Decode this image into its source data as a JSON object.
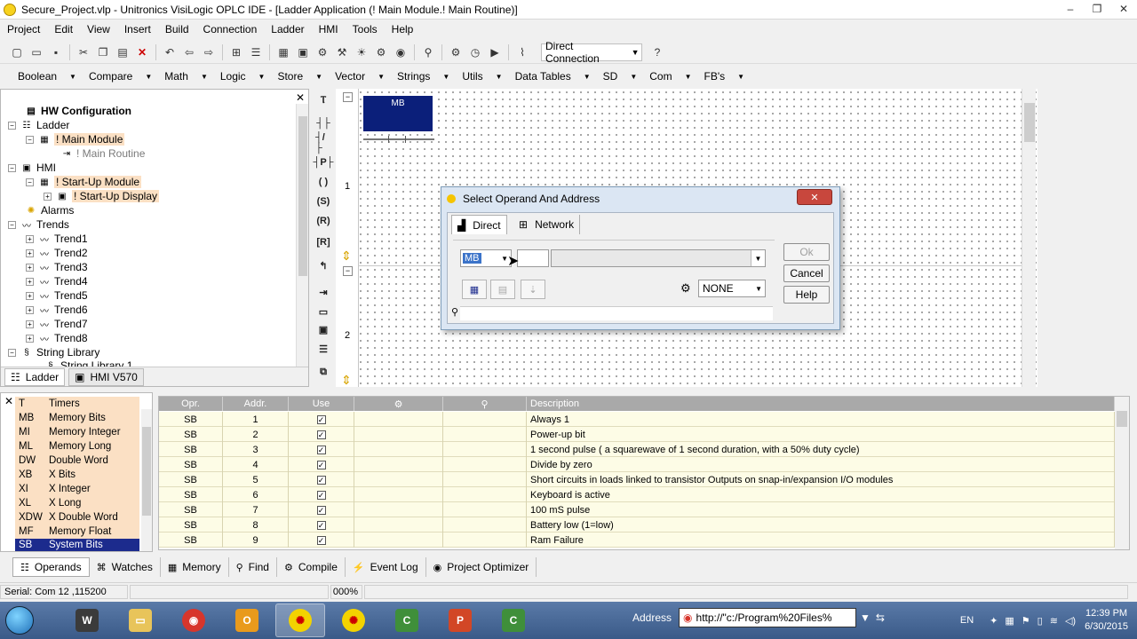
{
  "window": {
    "title": "Secure_Project.vlp - Unitronics VisiLogic OPLC IDE - [Ladder Application (! Main Module.! Main Routine)]",
    "controls": [
      "–",
      "❐",
      "✕"
    ]
  },
  "menu": [
    "Project",
    "Edit",
    "View",
    "Insert",
    "Build",
    "Connection",
    "Ladder",
    "HMI",
    "Tools",
    "Help"
  ],
  "toolbar": {
    "connection_value": "Direct Connection"
  },
  "element_menus": [
    "Boolean",
    "Compare",
    "Math",
    "Logic",
    "Store",
    "Vector",
    "Strings",
    "Utils",
    "Data Tables",
    "SD",
    "Com",
    "FB's"
  ],
  "tree": {
    "hw_config": "HW Configuration",
    "ladder": "Ladder",
    "main_module": "! Main Module",
    "main_routine": "! Main Routine",
    "hmi": "HMI",
    "startup_module": "! Start-Up Module",
    "startup_display": "! Start-Up Display",
    "alarms": "Alarms",
    "trends": "Trends",
    "trend_items": [
      "Trend1",
      "Trend2",
      "Trend3",
      "Trend4",
      "Trend5",
      "Trend6",
      "Trend7",
      "Trend8"
    ],
    "string_library": "String Library",
    "string_library_child": "String Library 1",
    "tabs": [
      "Ladder",
      "HMI V570"
    ]
  },
  "ladder": {
    "rung_numbers": [
      "1",
      "2"
    ],
    "block_label": "MB"
  },
  "dialog": {
    "title": "Select Operand And Address",
    "close": "✕",
    "tabs": [
      "Direct",
      "Network"
    ],
    "operand_value": "MB",
    "address_value": "",
    "format_value": "NONE",
    "buttons": {
      "ok": "Ok",
      "cancel": "Cancel",
      "help": "Help"
    }
  },
  "operands": [
    {
      "code": "T",
      "name": "Timers"
    },
    {
      "code": "MB",
      "name": "Memory Bits"
    },
    {
      "code": "MI",
      "name": "Memory Integer"
    },
    {
      "code": "ML",
      "name": "Memory Long"
    },
    {
      "code": "DW",
      "name": "Double Word"
    },
    {
      "code": "XB",
      "name": "X Bits"
    },
    {
      "code": "XI",
      "name": "X Integer"
    },
    {
      "code": "XL",
      "name": "X Long"
    },
    {
      "code": "XDW",
      "name": "X Double Word"
    },
    {
      "code": "MF",
      "name": "Memory Float"
    },
    {
      "code": "SB",
      "name": "System Bits"
    }
  ],
  "table": {
    "headers": {
      "opr": "Opr.",
      "addr": "Addr.",
      "use": "Use",
      "desc": "Description"
    },
    "rows": [
      {
        "opr": "SB",
        "addr": "1",
        "desc": "Always 1"
      },
      {
        "opr": "SB",
        "addr": "2",
        "desc": "Power-up bit"
      },
      {
        "opr": "SB",
        "addr": "3",
        "desc": "1 second pulse ( a squarewave of 1 second duration, with a 50% duty cycle)"
      },
      {
        "opr": "SB",
        "addr": "4",
        "desc": "Divide by zero"
      },
      {
        "opr": "SB",
        "addr": "5",
        "desc": "Short circuits in loads linked to transistor Outputs on snap-in/expansion I/O modules"
      },
      {
        "opr": "SB",
        "addr": "6",
        "desc": "Keyboard is active"
      },
      {
        "opr": "SB",
        "addr": "7",
        "desc": "100 mS pulse"
      },
      {
        "opr": "SB",
        "addr": "8",
        "desc": "Battery low (1=low)"
      },
      {
        "opr": "SB",
        "addr": "9",
        "desc": "Ram Failure"
      }
    ]
  },
  "bottom_tabs": [
    "Operands",
    "Watches",
    "Memory",
    "Find",
    "Compile",
    "Event Log",
    "Project Optimizer"
  ],
  "status": {
    "connection": "Serial:  Com 12 ,115200",
    "zoom": "000%"
  },
  "taskbar": {
    "address_label": "Address",
    "address_value": "http://\"c:/Program%20Files%",
    "language": "EN",
    "time": "12:39 PM",
    "date": "6/30/2015"
  },
  "colors": {
    "accent_block": "#0b1f7a",
    "highlight": "#fbe0c4",
    "selection": "#1c2b8d"
  }
}
